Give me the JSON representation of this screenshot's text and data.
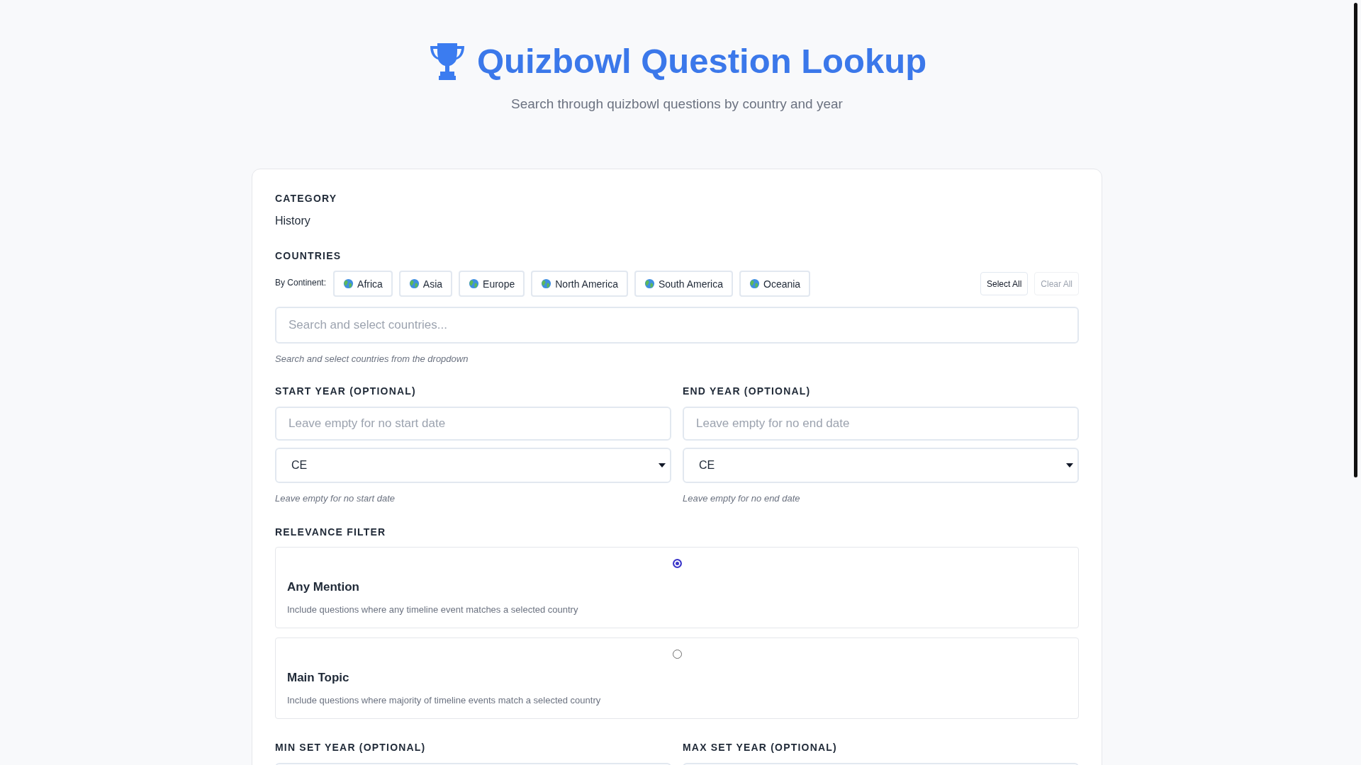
{
  "header": {
    "title": "Quizbowl Question Lookup",
    "subtitle": "Search through quizbowl questions by country and year"
  },
  "category": {
    "label": "CATEGORY",
    "value": "History"
  },
  "countries": {
    "label": "COUNTRIES",
    "by_continent_label": "By Continent:",
    "continents": [
      "Africa",
      "Asia",
      "Europe",
      "North America",
      "South America",
      "Oceania"
    ],
    "actions": [
      {
        "label": "Select All",
        "disabled": false
      },
      {
        "label": "Clear All",
        "disabled": true
      }
    ],
    "search": {
      "placeholder": "Search and select countries..."
    },
    "hint": "Search and select countries from the dropdown"
  },
  "year_range": [
    {
      "label": "START YEAR (OPTIONAL)",
      "placeholder": "Leave empty for no start date",
      "era": "CE",
      "hint": "Leave empty for no start date"
    },
    {
      "label": "END YEAR (OPTIONAL)",
      "placeholder": "Leave empty for no end date",
      "era": "CE",
      "hint": "Leave empty for no end date"
    }
  ],
  "relevance": {
    "label": "RELEVANCE FILTER",
    "options": [
      {
        "title": "Any Mention",
        "description": "Include questions where any timeline event matches a selected country",
        "selected": true
      },
      {
        "title": "Main Topic",
        "description": "Include questions where majority of timeline events match a selected country",
        "selected": false
      }
    ]
  },
  "set_years": [
    {
      "label": "MIN SET YEAR (OPTIONAL)"
    },
    {
      "label": "MAX SET YEAR (OPTIONAL)"
    }
  ]
}
